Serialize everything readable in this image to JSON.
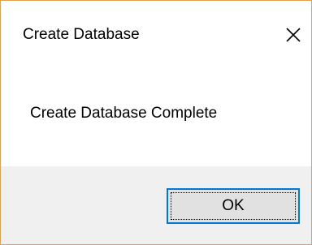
{
  "window": {
    "title": "Create Database",
    "close_icon": "close-icon",
    "accent_border_color": "#e0a24a"
  },
  "dialog": {
    "message": "Create Database Complete",
    "ok_label": "OK",
    "focus_color": "#0078d7"
  }
}
